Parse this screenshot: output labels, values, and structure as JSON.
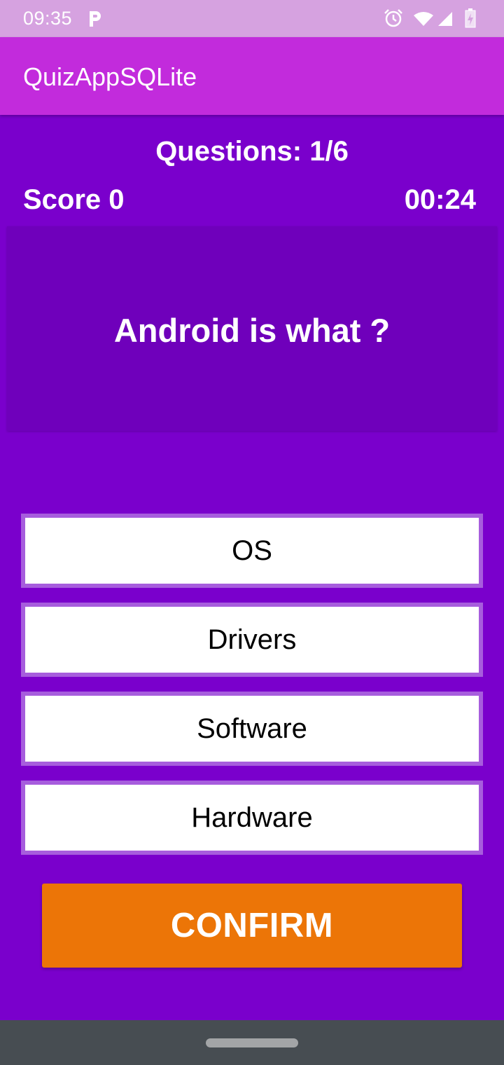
{
  "status_bar": {
    "time": "09:35",
    "icons": [
      "parking-icon",
      "alarm-icon",
      "wifi-icon",
      "signal-icon",
      "battery-icon"
    ]
  },
  "app_bar": {
    "title": "QuizAppSQLite"
  },
  "quiz": {
    "questions_count": "Questions: 1/6",
    "score": "Score 0",
    "timer": "00:24",
    "question": "Android is what ?",
    "options": [
      "OS",
      "Drivers",
      "Software",
      "Hardware"
    ],
    "confirm_label": "CONFIRM"
  },
  "colors": {
    "status_bar": "#d6a2e0",
    "app_bar": "#c22bdc",
    "background": "#7a00cc",
    "question_card": "#6f00bb",
    "option_border": "#a75ddd",
    "confirm_button": "#ec7507",
    "nav_bar": "#474d52"
  }
}
